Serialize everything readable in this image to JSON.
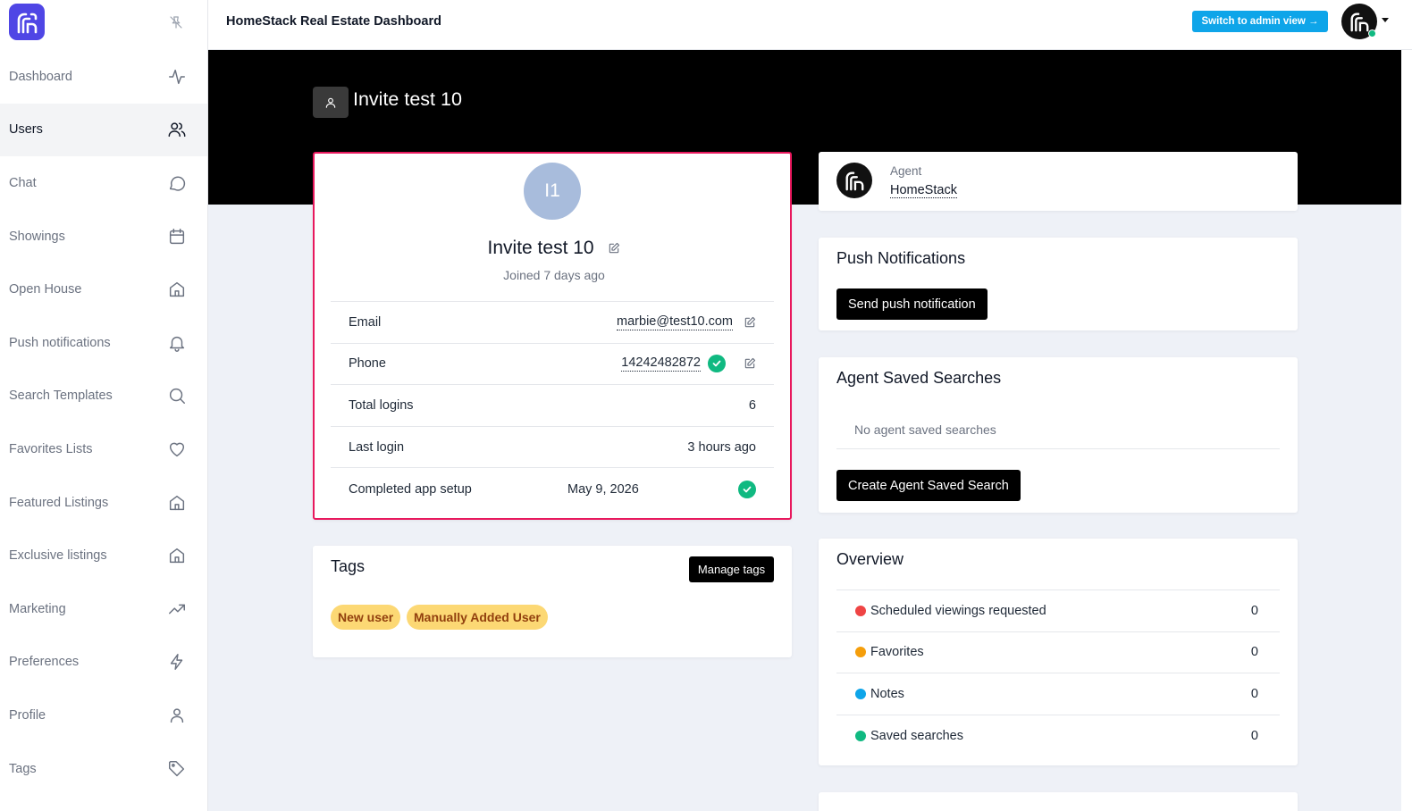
{
  "header": {
    "app_title": "HomeStack Real Estate Dashboard",
    "admin_button": "Switch to admin view →"
  },
  "sidebar": {
    "items": [
      {
        "label": "Dashboard",
        "icon": "activity-icon"
      },
      {
        "label": "Users",
        "icon": "users-icon",
        "active": true
      },
      {
        "label": "Chat",
        "icon": "chat-icon"
      },
      {
        "label": "Showings",
        "icon": "calendar-icon"
      },
      {
        "label": "Open House",
        "icon": "home-icon"
      },
      {
        "label": "Push notifications",
        "icon": "bell-icon"
      },
      {
        "label": "Search Templates",
        "icon": "search-icon"
      },
      {
        "label": "Favorites Lists",
        "icon": "heart-icon"
      },
      {
        "label": "Featured Listings",
        "icon": "home-icon"
      },
      {
        "label": "Exclusive listings",
        "icon": "home-icon"
      },
      {
        "label": "Marketing",
        "icon": "trending-up-icon"
      },
      {
        "label": "Preferences",
        "icon": "lightning-icon"
      },
      {
        "label": "Profile",
        "icon": "user-icon"
      },
      {
        "label": "Tags",
        "icon": "tag-icon"
      }
    ]
  },
  "page": {
    "title": "Invite test 10"
  },
  "user": {
    "initials": "I1",
    "name": "Invite test 10",
    "joined": "Joined 7 days ago",
    "email_label": "Email",
    "email": "marbie@test10.com",
    "phone_label": "Phone",
    "phone": "14242482872",
    "logins_label": "Total logins",
    "logins": "6",
    "last_login_label": "Last login",
    "last_login": "3 hours ago",
    "setup_label": "Completed app setup",
    "setup_date": "May 9, 2026"
  },
  "tags": {
    "title": "Tags",
    "manage_button": "Manage tags",
    "items": [
      "New user",
      "Manually Added User"
    ]
  },
  "agent": {
    "label": "Agent",
    "name": "HomeStack"
  },
  "push": {
    "title": "Push Notifications",
    "button": "Send push notification"
  },
  "saved_searches": {
    "title": "Agent Saved Searches",
    "empty": "No agent saved searches",
    "button": "Create Agent Saved Search"
  },
  "overview": {
    "title": "Overview",
    "rows": [
      {
        "label": "Scheduled viewings requested",
        "value": "0",
        "color": "#ef4444"
      },
      {
        "label": "Favorites",
        "value": "0",
        "color": "#f59e0b"
      },
      {
        "label": "Notes",
        "value": "0",
        "color": "#0ea5e9"
      },
      {
        "label": "Saved searches",
        "value": "0",
        "color": "#10b981"
      }
    ]
  },
  "colors": {
    "brand": "#4f46e5",
    "admin_button": "#0ea5e9",
    "highlight_border": "#e8185d",
    "success": "#10b981",
    "tag_bg": "#fcd874"
  }
}
